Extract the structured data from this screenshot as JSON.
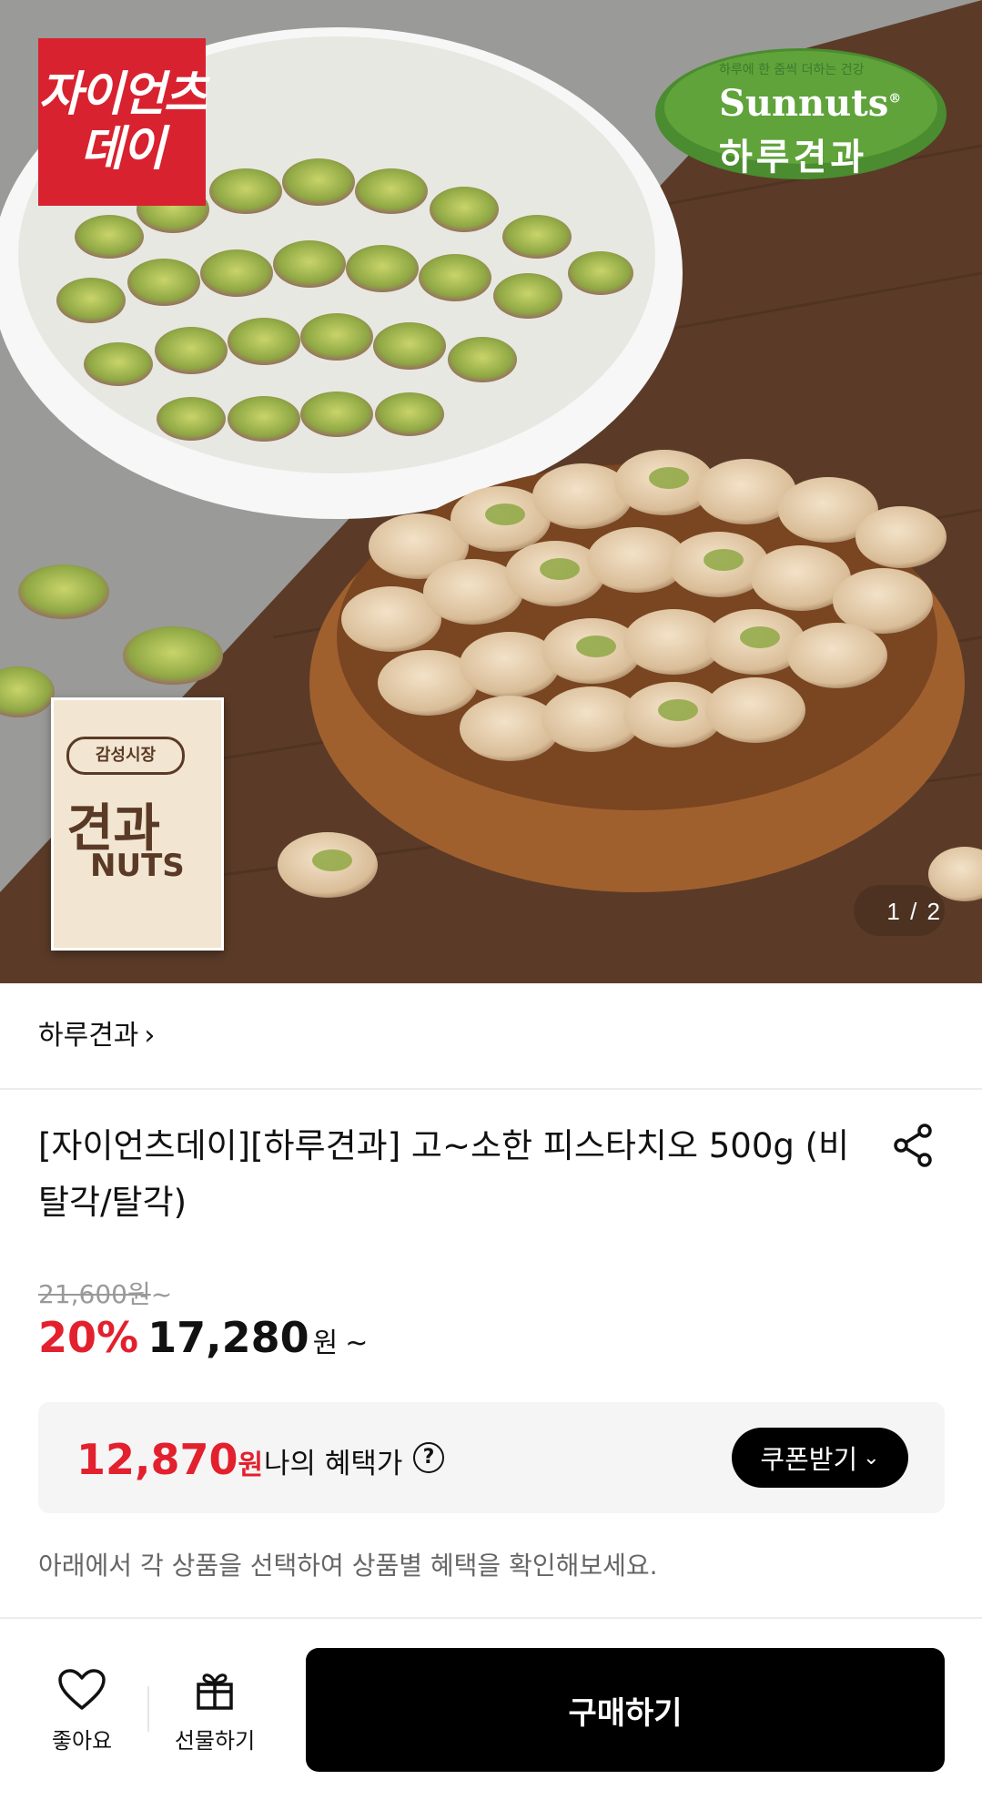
{
  "hero": {
    "brand_logo_line1": "자이언츠",
    "brand_logo_line2": "데이",
    "sunnuts_tagline": "하루에 한 줌씩 더하는 건강",
    "sunnuts_en": "Sunnuts",
    "sunnuts_reg": "®",
    "sunnuts_ko": "하루견과",
    "package_label": "감성시장",
    "package_big": "견과",
    "package_nuts": "NUTS",
    "counter": "1 / 2"
  },
  "seller": {
    "name": "하루견과",
    "chevron": "›"
  },
  "product": {
    "title": "[자이언츠데이][하루견과] 고~소한 피스타치오 500g (비탈각/탈각)",
    "original_price": "21,600원",
    "original_suffix": "~",
    "discount": "20%",
    "sale_price": "17,280",
    "won": "원",
    "tilde": "~"
  },
  "benefit": {
    "price": "12,870",
    "won": "원",
    "label": "나의 혜택가",
    "help": "?",
    "coupon_label": "쿠폰받기",
    "coupon_chevron": "⌄"
  },
  "note": "아래에서 각 상품을 선택하여 상품별 혜택을 확인해보세요.",
  "bottom_bar": {
    "favorite_label": "좋아요",
    "gift_label": "선물하기",
    "buy_label": "구매하기"
  },
  "colors": {
    "accent_red": "#e3202e",
    "black": "#000000",
    "logo_red": "#d8222f"
  }
}
